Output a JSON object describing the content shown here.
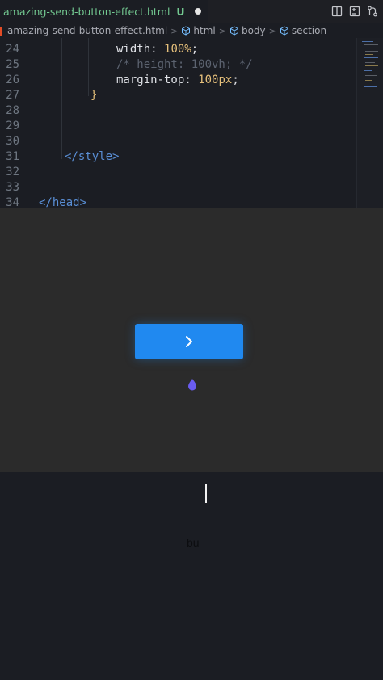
{
  "tab": {
    "filename": "amazing-send-button-effect.html",
    "status": "U"
  },
  "actions": {
    "icons": [
      "split-editor-icon",
      "open-changes-icon",
      "source-control-icon"
    ]
  },
  "breadcrumb": {
    "file": "amazing-send-button-effect.html",
    "items": [
      "html",
      "body",
      "section"
    ]
  },
  "editor": {
    "lines": [
      {
        "n": "24",
        "indent": 100,
        "tokens": [
          {
            "t": "width",
            "c": "prop"
          },
          {
            "t": ": ",
            "c": "punct"
          },
          {
            "t": "100%",
            "c": "val"
          },
          {
            "t": ";",
            "c": "punct"
          }
        ]
      },
      {
        "n": "25",
        "indent": 100,
        "tokens": [
          {
            "t": "/* height: 100vh; */",
            "c": "comment"
          }
        ]
      },
      {
        "n": "26",
        "indent": 100,
        "tokens": [
          {
            "t": "margin-top",
            "c": "prop"
          },
          {
            "t": ": ",
            "c": "punct"
          },
          {
            "t": "100px",
            "c": "val"
          },
          {
            "t": ";",
            "c": "punct"
          }
        ]
      },
      {
        "n": "27",
        "indent": 68,
        "tokens": [
          {
            "t": "}",
            "c": "brace"
          }
        ]
      },
      {
        "n": "28",
        "indent": 0,
        "tokens": []
      },
      {
        "n": "29",
        "indent": 0,
        "tokens": []
      },
      {
        "n": "30",
        "indent": 0,
        "tokens": []
      },
      {
        "n": "31",
        "indent": 36,
        "tokens": [
          {
            "t": "</style>",
            "c": "tag"
          }
        ]
      },
      {
        "n": "32",
        "indent": 0,
        "tokens": []
      },
      {
        "n": "33",
        "indent": 0,
        "tokens": []
      },
      {
        "n": "34",
        "indent": 4,
        "tokens": [
          {
            "t": "</head>",
            "c": "tag"
          }
        ]
      }
    ]
  },
  "preview": {
    "button_icon": "chevron-right-icon",
    "button_color": "#2089f0",
    "drop_color": "#6a5cf0",
    "background": "#2b2b2b"
  },
  "bottom": {
    "typed_text": "bu"
  },
  "colors": {
    "editor_bg": "#1b1d23",
    "modified_tab_text": "#73c991"
  }
}
